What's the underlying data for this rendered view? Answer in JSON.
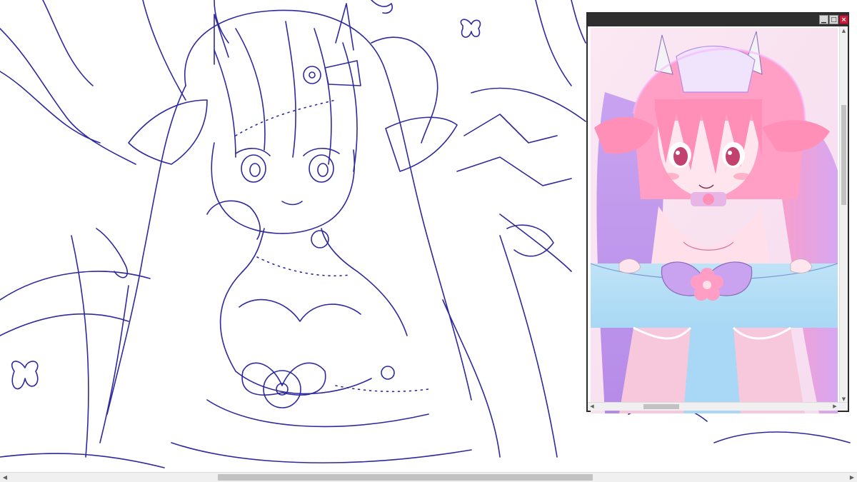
{
  "app": {
    "colors": {
      "lineart": "#2e2a9e",
      "canvas_bg": "#ffffff",
      "window_titlebar": "#2f2f2f",
      "close_button": "#c81d3b",
      "scroll_track": "#f0f0f0",
      "scroll_thumb": "#c2c2c2"
    }
  },
  "canvas": {
    "subject": "lineart-sketch"
  },
  "reference_window": {
    "title": "",
    "buttons": {
      "minimize_glyph": "▁",
      "maximize_glyph": "□",
      "close_glyph": "×"
    },
    "image": "colored-reference",
    "palette": [
      "#f4a7c8",
      "#c9a3f0",
      "#a8d8f5",
      "#ff8fb7",
      "#b58be8"
    ]
  },
  "scrollbars": {
    "left_arrow": "◀",
    "right_arrow": "▶",
    "up_arrow": "▲",
    "down_arrow": "▼"
  }
}
